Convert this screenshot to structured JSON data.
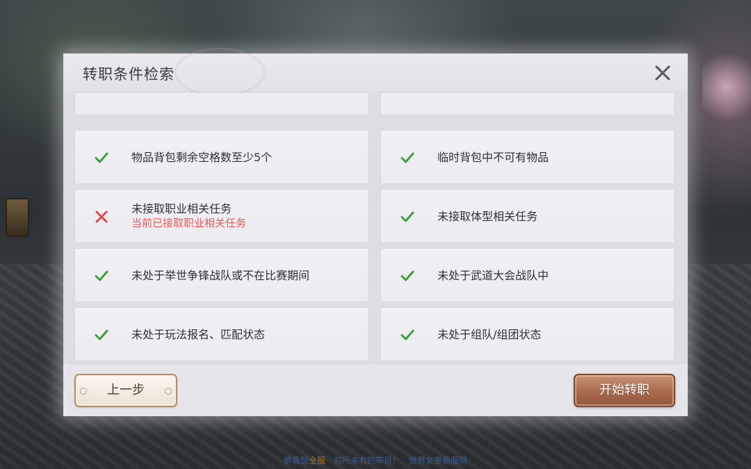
{
  "dialog": {
    "title": "转职条件检索",
    "close_icon": "close-icon"
  },
  "conditions": [
    {
      "label": "",
      "met": null
    },
    {
      "label": "",
      "met": null
    },
    {
      "label": "物品背包剩余空格数至少5个",
      "met": true
    },
    {
      "label": "临时背包中不可有物品",
      "met": true
    },
    {
      "label": "未接取职业相关任务",
      "met": false,
      "error": "当前已接取职业相关任务"
    },
    {
      "label": "未接取体型相关任务",
      "met": true
    },
    {
      "label": "未处于举世争锋战队或不在比赛期间",
      "met": true
    },
    {
      "label": "未处于武道大会战队中",
      "met": true
    },
    {
      "label": "未处于玩法报名、匹配状态",
      "met": true
    },
    {
      "label": "未处于组队/组团状态",
      "met": true
    }
  ],
  "footer": {
    "prev_label": "上一步",
    "start_label": "开始转职"
  },
  "colors": {
    "check": "#3aa13a",
    "cross": "#e0454a",
    "error_text": "#e85a5a",
    "start_button": "#a8694c"
  },
  "background": {
    "ticker_prefix": "恭喜盟",
    "ticker_highlight": "全服",
    "ticker_mid": "前所未有的卒目！",
    "ticker_suffix": "世界女皇霸服网"
  }
}
